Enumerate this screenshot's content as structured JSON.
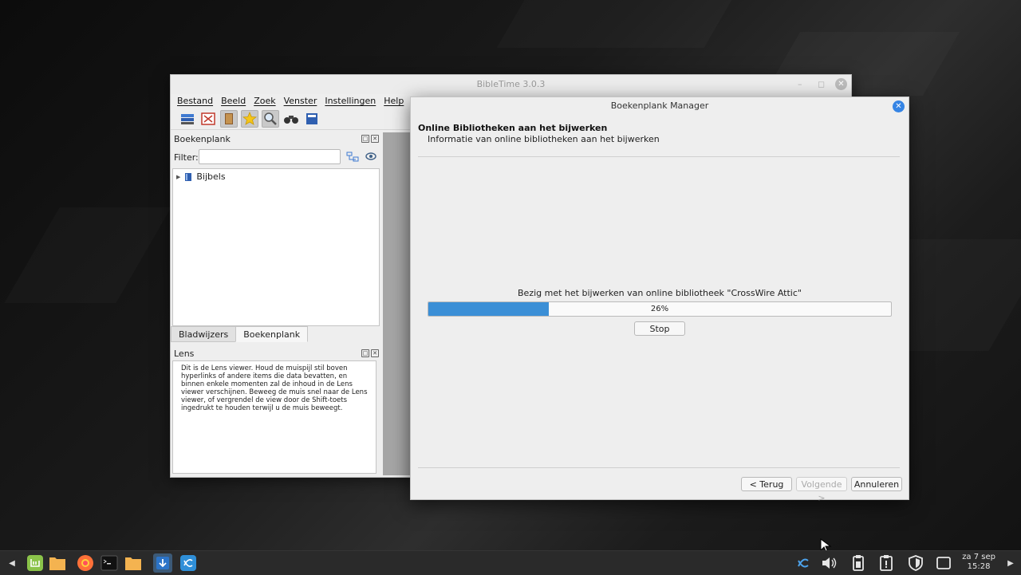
{
  "main_window": {
    "title": "BibleTime 3.0.3",
    "menu": [
      "Bestand",
      "Beeld",
      "Zoek",
      "Venster",
      "Instellingen",
      "Help"
    ],
    "bookshelf": {
      "title": "Boekenplank",
      "filter_label": "Filter:",
      "filter_value": "",
      "tree": [
        {
          "label": "Bijbels",
          "expanded": false
        }
      ]
    },
    "tabs": [
      {
        "label": "Bladwijzers",
        "active": false
      },
      {
        "label": "Boekenplank",
        "active": true
      }
    ],
    "lens": {
      "title": "Lens",
      "text": "Dit is de Lens viewer. Houd de muispijl stil boven hyperlinks of andere items die data bevatten, en binnen enkele momenten zal de inhoud in de Lens viewer verschijnen. Beweeg de muis snel naar de Lens viewer, of vergrendel de view door de Shift-toets ingedrukt te houden terwijl u de muis beweegt."
    }
  },
  "dialog": {
    "title": "Boekenplank Manager",
    "heading": "Online Bibliotheken aan het bijwerken",
    "subheading": "Informatie van online bibliotheken aan het bijwerken",
    "status": "Bezig met het bijwerken van online bibliotheek \"CrossWire Attic\"",
    "progress_percent": 26,
    "progress_label": "26%",
    "stop_label": "Stop",
    "back_label": "< Terug",
    "next_label": "Volgende >",
    "cancel_label": "Annuleren"
  },
  "taskbar": {
    "date": "za  7 sep",
    "time": "15:28"
  },
  "colors": {
    "accent": "#3584e4",
    "progress": "#3b8fd6",
    "mint": "#8bc34a",
    "folder": "#f4b350"
  }
}
